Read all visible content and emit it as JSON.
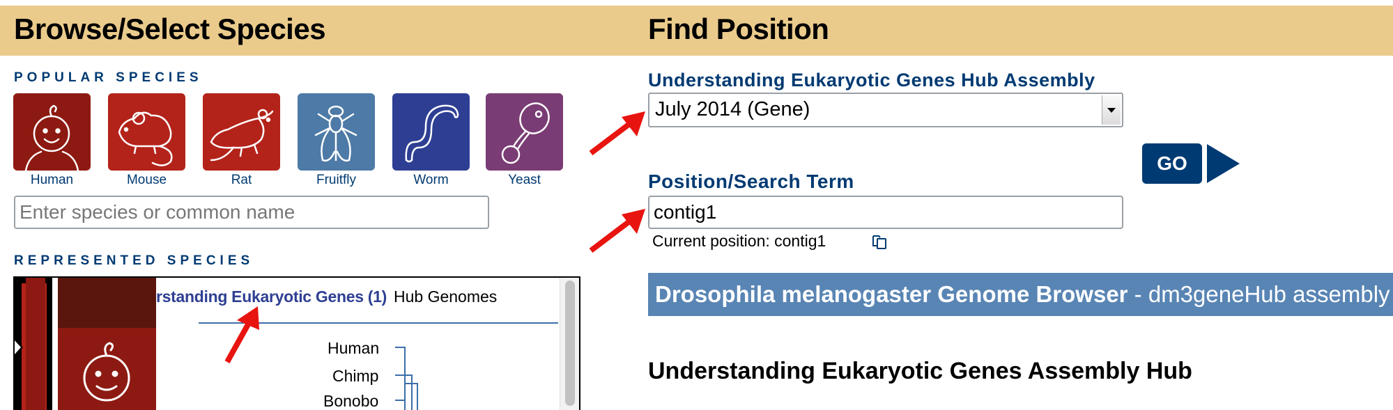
{
  "left_panel": {
    "title": "Browse/Select Species",
    "popular_heading": "POPULAR SPECIES",
    "species": [
      {
        "label": "Human",
        "icon": "human-icon",
        "color": "#8d1a12"
      },
      {
        "label": "Mouse",
        "icon": "mouse-icon",
        "color": "#b3231a"
      },
      {
        "label": "Rat",
        "icon": "rat-icon",
        "color": "#b3231a"
      },
      {
        "label": "Fruitfly",
        "icon": "fruitfly-icon",
        "color": "#4d7aa6"
      },
      {
        "label": "Worm",
        "icon": "worm-icon",
        "color": "#2e3f93"
      },
      {
        "label": "Yeast",
        "icon": "yeast-icon",
        "color": "#7a3c74"
      }
    ],
    "search_placeholder": "Enter species or common name",
    "represented_heading": "REPRESENTED SPECIES",
    "hub_tab_link": "rstanding Eukaryotic Genes (1)",
    "hub_tab_label": "Hub Genomes",
    "tree": [
      "Human",
      "Chimp",
      "Bonobo"
    ]
  },
  "right_panel": {
    "title": "Find Position",
    "assembly_label": "Understanding Eukaryotic Genes Hub Assembly",
    "assembly_value": "July 2014 (Gene)",
    "position_label": "Position/Search Term",
    "position_value": "contig1",
    "current_position": "Current position: contig1",
    "go_label": "GO",
    "browser_title_bold": "Drosophila melanogaster Genome Browser",
    "browser_title_rest": " - dm3geneHub assembly",
    "hub_heading": "Understanding Eukaryotic Genes Assembly Hub"
  },
  "colors": {
    "header_bar": "#eacb8c",
    "accent_blue": "#003a72",
    "browser_bar": "#5985b4",
    "arrow_red": "#e8140f"
  }
}
